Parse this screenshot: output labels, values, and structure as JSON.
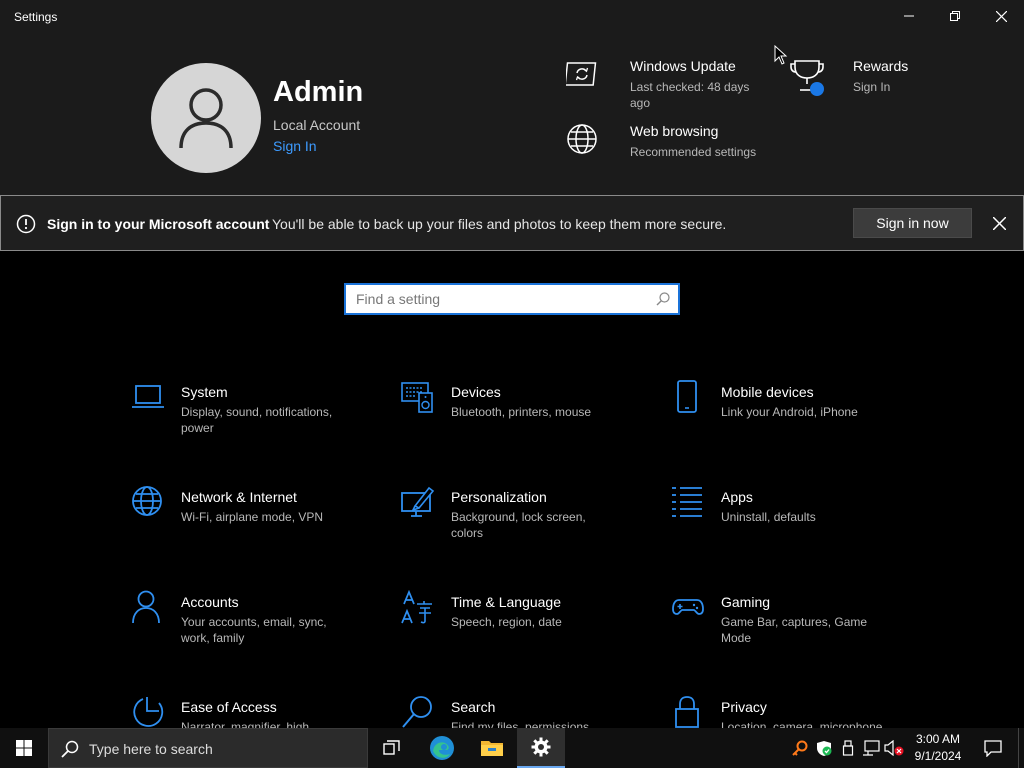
{
  "window": {
    "title": "Settings"
  },
  "profile": {
    "name": "Admin",
    "account_type": "Local Account",
    "sign_in_link": "Sign In"
  },
  "header_items": [
    {
      "title": "Windows Update",
      "subtitle": "Last checked: 48 days ago",
      "icon": "sync-icon"
    },
    {
      "title": "Web browsing",
      "subtitle": "Recommended settings",
      "icon": "globe-icon"
    },
    {
      "title": "Rewards",
      "subtitle": "Sign In",
      "icon": "trophy-icon"
    }
  ],
  "banner": {
    "title": "Sign in to your Microsoft account",
    "text": "You'll be able to back up your files and photos to keep them more secure.",
    "button": "Sign in now"
  },
  "search": {
    "placeholder": "Find a setting"
  },
  "categories": [
    {
      "title": "System",
      "subtitle": "Display, sound, notifications, power",
      "icon": "laptop-icon"
    },
    {
      "title": "Devices",
      "subtitle": "Bluetooth, printers, mouse",
      "icon": "keyboard-speaker-icon"
    },
    {
      "title": "Mobile devices",
      "subtitle": "Link your Android, iPhone",
      "icon": "phone-icon"
    },
    {
      "title": "Network & Internet",
      "subtitle": "Wi-Fi, airplane mode, VPN",
      "icon": "globe-icon"
    },
    {
      "title": "Personalization",
      "subtitle": "Background, lock screen, colors",
      "icon": "monitor-pen-icon"
    },
    {
      "title": "Apps",
      "subtitle": "Uninstall, defaults",
      "icon": "apps-list-icon"
    },
    {
      "title": "Accounts",
      "subtitle": "Your accounts, email, sync, work, family",
      "icon": "person-icon"
    },
    {
      "title": "Time & Language",
      "subtitle": "Speech, region, date",
      "icon": "language-icon"
    },
    {
      "title": "Gaming",
      "subtitle": "Game Bar, captures, Game Mode",
      "icon": "gamepad-icon"
    },
    {
      "title": "Ease of Access",
      "subtitle": "Narrator, magnifier, high contrast",
      "icon": "ease-of-access-icon"
    },
    {
      "title": "Search",
      "subtitle": "Find my files, permissions",
      "icon": "search-icon"
    },
    {
      "title": "Privacy",
      "subtitle": "Location, camera, microphone",
      "icon": "lock-icon"
    }
  ],
  "taskbar": {
    "search_placeholder": "Type here to search",
    "apps": [
      "task-view-icon",
      "edge-icon",
      "file-explorer-icon",
      "settings-gear-icon"
    ],
    "clock_time": "3:00 AM",
    "clock_date": "9/1/2024"
  },
  "colors": {
    "accent": "#3d9bff",
    "icon_blue": "#2f8ff0",
    "background": "#000000",
    "header_bg": "#1b1b1b"
  }
}
